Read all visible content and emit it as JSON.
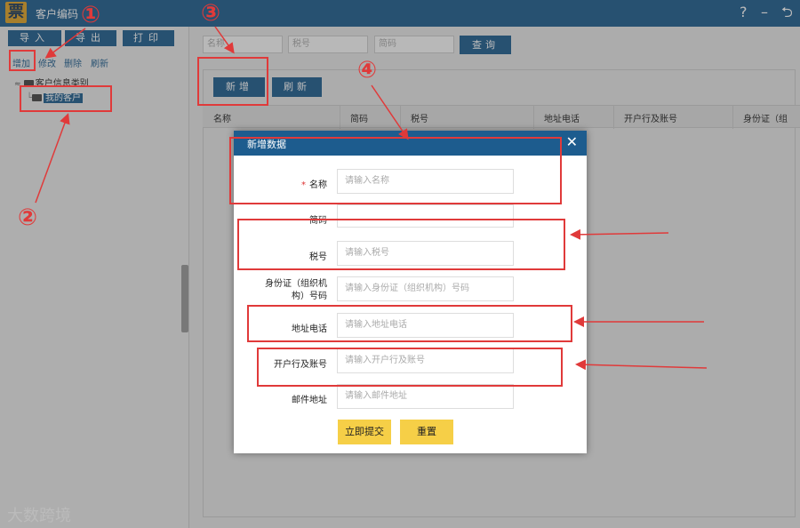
{
  "app": {
    "logo_char": "票",
    "title": "客户编码",
    "ctrl_help": "?",
    "ctrl_min": "–",
    "ctrl_back": "⮌"
  },
  "left": {
    "import_label": "导入",
    "export_label": "导出",
    "print_label": "打印",
    "links": {
      "add": "增加",
      "edit": "修改",
      "delete": "删除",
      "refresh": "刷新"
    },
    "tree_root": "客户信息类别",
    "tree_child": "我的客户",
    "tree_expander": "≈"
  },
  "search": {
    "name_placeholder": "名称",
    "tax_placeholder": "税号",
    "code_placeholder": "简码",
    "query_label": "查询"
  },
  "toolbar": {
    "add_label": "新增",
    "refresh_label": "刷新"
  },
  "grid": {
    "columns": [
      "名称",
      "简码",
      "税号",
      "地址电话",
      "开户行及账号",
      "身份证（组"
    ]
  },
  "dialog": {
    "title": "新增数据",
    "close": "✕",
    "required_mark": "*",
    "fields": [
      {
        "label": "名称",
        "placeholder": "请输入名称"
      },
      {
        "label": "简码",
        "placeholder": ""
      },
      {
        "label": "税号",
        "placeholder": "请输入税号"
      },
      {
        "label": "身份证（组织机构）号码",
        "placeholder": "请输入身份证（组织机构）号码"
      },
      {
        "label": "地址电话",
        "placeholder": "请输入地址电话"
      },
      {
        "label": "开户行及账号",
        "placeholder": "请输入开户行及账号"
      },
      {
        "label": "邮件地址",
        "placeholder": "请输入邮件地址"
      }
    ],
    "submit_label": "立即提交",
    "reset_label": "重置"
  },
  "annotations": [
    "①",
    "②",
    "③",
    "④"
  ],
  "watermark": "大数跨境",
  "colors": {
    "primary": "#1d5c8e",
    "annotation": "#e03a3a",
    "button_yellow": "#f6cf47"
  }
}
